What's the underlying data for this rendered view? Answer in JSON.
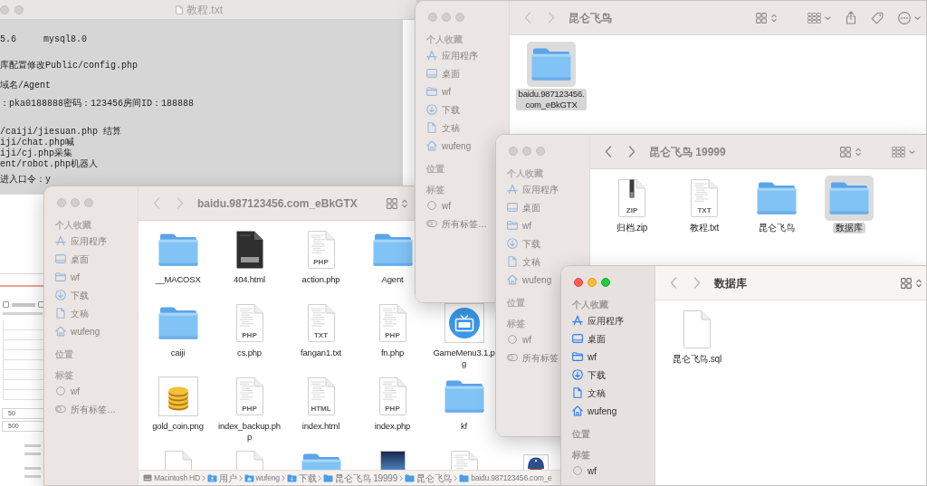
{
  "text_editor": {
    "title": "教程.txt",
    "active": false,
    "paragraphs": [
      [
        "5.6     mysql8.0"
      ],
      [
        "库配置修改Public/config.php"
      ],
      [
        "域名/Agent"
      ],
      [
        "：pka0188888密码：123456房间ID：188888"
      ],
      [
        "/caiji/jiesuan.php 结算",
        "iji/chat.php喊",
        "iji/cj.php采集",
        "ent/robot.php机器人"
      ],
      [
        "进入口令：y"
      ]
    ]
  },
  "background_page": {
    "checkboxes": [
      {
        "checked": false
      },
      {
        "checked": false
      }
    ],
    "fields": [
      {
        "value": "50"
      },
      {
        "value": "500"
      }
    ]
  },
  "windows": [
    {
      "title": "baidu.987123456.com_eBkGTX",
      "active": false,
      "back_disabled": true,
      "forward_disabled": true,
      "toolbar": [
        {
          "kind": "view"
        }
      ],
      "sidebar": [
        {
          "heading": "个人收藏",
          "items": [
            {
              "label": "应用程序",
              "kind": "apps"
            },
            {
              "label": "桌面",
              "kind": "desktop"
            },
            {
              "label": "wf",
              "kind": "folder"
            },
            {
              "label": "下载",
              "kind": "download"
            },
            {
              "label": "文稿",
              "kind": "document"
            },
            {
              "label": "wufeng",
              "kind": "home"
            }
          ]
        },
        {
          "heading": "位置"
        },
        {
          "heading": "标签",
          "items": [
            {
              "label": "wf",
              "kind": "tag"
            },
            {
              "label": "所有标签…",
              "kind": "all-tags"
            }
          ]
        }
      ],
      "rows": [
        [
          {
            "name": "__MACOSX",
            "kind": "folder",
            "selected": false
          },
          {
            "name": "404.html",
            "kind": "dark-page",
            "selected": false
          },
          {
            "name": "action.php",
            "kind": "document",
            "badge": "PHP",
            "selected": false
          },
          {
            "name": "Agent",
            "kind": "folder",
            "selected": false
          }
        ],
        [
          {
            "name": "caiji",
            "kind": "folder",
            "selected": false
          },
          {
            "name": "cs.php",
            "kind": "document",
            "badge": "PHP",
            "selected": false
          },
          {
            "name": "fangan1.txt",
            "kind": "document",
            "badge": "TXT",
            "selected": false
          },
          {
            "name": "fn.php",
            "kind": "document",
            "badge": "PHP",
            "selected": false
          },
          {
            "name": "GameMenu3.1.p\ng",
            "kind": "live-image",
            "selected": false
          }
        ],
        [
          {
            "name": "gold_coin.png",
            "kind": "coin-image",
            "selected": false
          },
          {
            "name": "index_backup.ph\np",
            "kind": "document",
            "badge": "PHP",
            "selected": false
          },
          {
            "name": "index.html",
            "kind": "document",
            "badge": "HTML",
            "selected": false
          },
          {
            "name": "index.php",
            "kind": "document",
            "badge": "PHP",
            "selected": false
          },
          {
            "name": "kf",
            "kind": "folder",
            "selected": false
          }
        ],
        [
          {
            "kind": "blank-document",
            "selected": false
          },
          {
            "kind": "blank-document",
            "selected": false
          },
          {
            "kind": "folder",
            "selected": false
          },
          {
            "kind": "photo-image",
            "selected": false
          },
          {
            "kind": "document",
            "selected": false
          },
          {
            "kind": "figure-image",
            "selected": false
          }
        ]
      ],
      "path_bar": [
        {
          "label": "Macintosh HD",
          "kind": "disk"
        },
        {
          "label": "用户",
          "kind": "users-folder"
        },
        {
          "label": "wufeng",
          "kind": "home-folder"
        },
        {
          "label": "下载",
          "kind": "downloads-folder"
        },
        {
          "label": "昆仑飞鸟 19999",
          "kind": "folder"
        },
        {
          "label": "昆仑飞鸟",
          "kind": "folder"
        },
        {
          "label": "baidu.987123456.com_e",
          "kind": "folder"
        }
      ]
    },
    {
      "title": "昆仑飞鸟",
      "active": false,
      "back_disabled": true,
      "forward_disabled": true,
      "toolbar": [
        {
          "kind": "view"
        },
        {
          "kind": "group"
        },
        {
          "kind": "share"
        },
        {
          "kind": "tag"
        },
        {
          "kind": "more"
        }
      ],
      "sidebar": [
        {
          "heading": "个人收藏",
          "items": [
            {
              "label": "应用程序",
              "kind": "apps"
            },
            {
              "label": "桌面",
              "kind": "desktop"
            },
            {
              "label": "wf",
              "kind": "folder"
            },
            {
              "label": "下载",
              "kind": "download"
            },
            {
              "label": "文稿",
              "kind": "document"
            },
            {
              "label": "wufeng",
              "kind": "home"
            }
          ]
        },
        {
          "heading": "位置"
        },
        {
          "heading": "标签",
          "items": [
            {
              "label": "wf",
              "kind": "tag"
            },
            {
              "label": "所有标签…",
              "kind": "all-tags"
            }
          ]
        }
      ],
      "rows": [
        [
          {
            "name": "baidu.987123456.\ncom_eBkGTX",
            "kind": "folder",
            "selected": true
          }
        ]
      ]
    },
    {
      "title": "昆仑飞鸟 19999",
      "active": false,
      "back_disabled": false,
      "forward_disabled": false,
      "toolbar": [
        {
          "kind": "view"
        },
        {
          "kind": "group"
        }
      ],
      "sidebar": [
        {
          "heading": "个人收藏",
          "items": [
            {
              "label": "应用程序",
              "kind": "apps"
            },
            {
              "label": "桌面",
              "kind": "desktop"
            },
            {
              "label": "wf",
              "kind": "folder"
            },
            {
              "label": "下载",
              "kind": "download"
            },
            {
              "label": "文稿",
              "kind": "document"
            },
            {
              "label": "wufeng",
              "kind": "home"
            }
          ]
        },
        {
          "heading": "位置"
        },
        {
          "heading": "标签",
          "items": [
            {
              "label": "wf",
              "kind": "tag"
            },
            {
              "label": "所有标签",
              "kind": "all-tags"
            }
          ]
        }
      ],
      "rows": [
        [
          {
            "name": "归档.zip",
            "kind": "zip",
            "badge": "ZIP",
            "selected": false
          },
          {
            "name": "教程.txt",
            "kind": "document",
            "badge": "TXT",
            "selected": false
          },
          {
            "name": "昆仑飞鸟",
            "kind": "folder",
            "selected": false
          },
          {
            "name": "数据库",
            "kind": "folder",
            "selected": true
          }
        ]
      ]
    },
    {
      "title": "数据库",
      "active": true,
      "back_disabled": true,
      "forward_disabled": true,
      "toolbar": [
        {
          "kind": "view"
        }
      ],
      "sidebar": [
        {
          "heading": "个人收藏",
          "items": [
            {
              "label": "应用程序",
              "kind": "apps"
            },
            {
              "label": "桌面",
              "kind": "desktop"
            },
            {
              "label": "wf",
              "kind": "folder"
            },
            {
              "label": "下载",
              "kind": "download"
            },
            {
              "label": "文稿",
              "kind": "document"
            },
            {
              "label": "wufeng",
              "kind": "home"
            }
          ]
        },
        {
          "heading": "位置"
        },
        {
          "heading": "标签",
          "items": [
            {
              "label": "wf",
              "kind": "tag"
            }
          ]
        }
      ],
      "rows": [
        [
          {
            "name": "昆仑飞鸟.sql",
            "kind": "blank-document",
            "selected": false
          }
        ]
      ]
    }
  ]
}
